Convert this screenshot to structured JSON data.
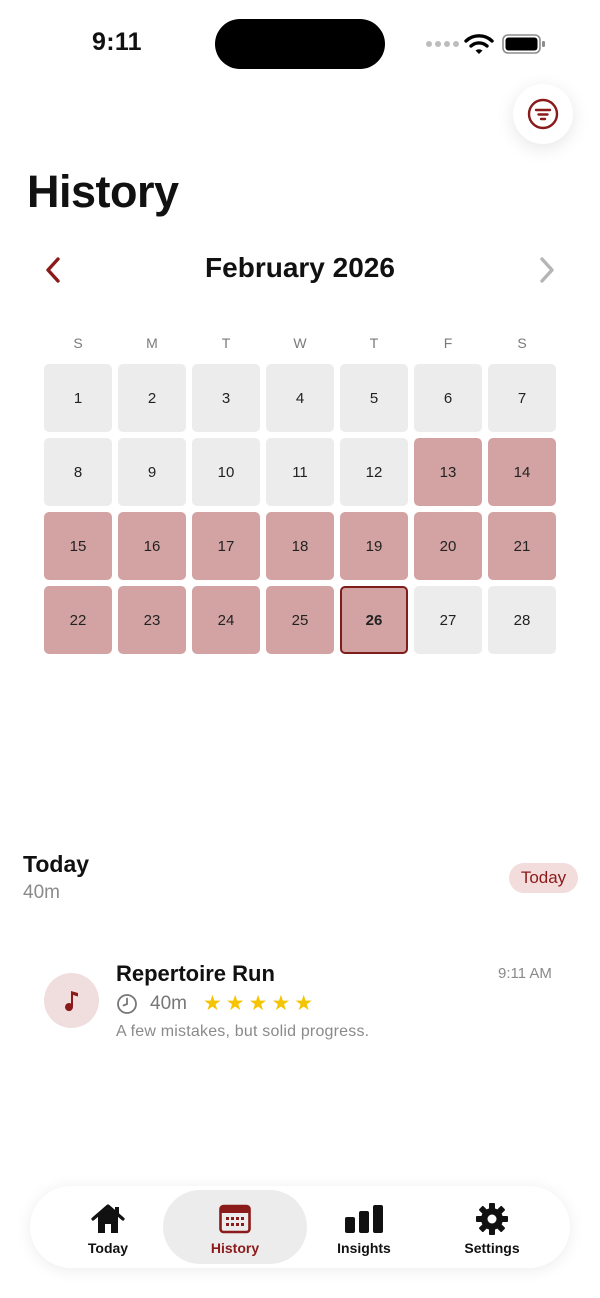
{
  "status_bar": {
    "time": "9:11"
  },
  "header": {
    "title": "History",
    "filter_icon": "filter-icon"
  },
  "calendar": {
    "month_label": "February 2026",
    "prev_icon": "chevron-left-icon",
    "next_icon": "chevron-right-icon",
    "weekdays": [
      "S",
      "M",
      "T",
      "W",
      "T",
      "F",
      "S"
    ],
    "days": [
      {
        "label": "1",
        "active": false,
        "selected": false
      },
      {
        "label": "2",
        "active": false,
        "selected": false
      },
      {
        "label": "3",
        "active": false,
        "selected": false
      },
      {
        "label": "4",
        "active": false,
        "selected": false
      },
      {
        "label": "5",
        "active": false,
        "selected": false
      },
      {
        "label": "6",
        "active": false,
        "selected": false
      },
      {
        "label": "7",
        "active": false,
        "selected": false
      },
      {
        "label": "8",
        "active": false,
        "selected": false
      },
      {
        "label": "9",
        "active": false,
        "selected": false
      },
      {
        "label": "10",
        "active": false,
        "selected": false
      },
      {
        "label": "11",
        "active": false,
        "selected": false
      },
      {
        "label": "12",
        "active": false,
        "selected": false
      },
      {
        "label": "13",
        "active": true,
        "selected": false
      },
      {
        "label": "14",
        "active": true,
        "selected": false
      },
      {
        "label": "15",
        "active": true,
        "selected": false
      },
      {
        "label": "16",
        "active": true,
        "selected": false
      },
      {
        "label": "17",
        "active": true,
        "selected": false
      },
      {
        "label": "18",
        "active": true,
        "selected": false
      },
      {
        "label": "19",
        "active": true,
        "selected": false
      },
      {
        "label": "20",
        "active": true,
        "selected": false
      },
      {
        "label": "21",
        "active": true,
        "selected": false
      },
      {
        "label": "22",
        "active": true,
        "selected": false
      },
      {
        "label": "23",
        "active": true,
        "selected": false
      },
      {
        "label": "24",
        "active": true,
        "selected": false
      },
      {
        "label": "25",
        "active": true,
        "selected": false
      },
      {
        "label": "26",
        "active": true,
        "selected": true
      },
      {
        "label": "27",
        "active": false,
        "selected": false
      },
      {
        "label": "28",
        "active": false,
        "selected": false
      }
    ]
  },
  "summary": {
    "title": "Today",
    "duration": "40m",
    "badge": "Today"
  },
  "session": {
    "icon": "music-note-icon",
    "title": "Repertoire Run",
    "time": "9:11 AM",
    "duration": "40m",
    "rating": 5,
    "note": "A few mistakes, but solid progress."
  },
  "tab_bar": {
    "tabs": [
      {
        "label": "Today",
        "icon": "home-icon",
        "selected": false
      },
      {
        "label": "History",
        "icon": "calendar-icon",
        "selected": true
      },
      {
        "label": "Insights",
        "icon": "bar-chart-icon",
        "selected": false
      },
      {
        "label": "Settings",
        "icon": "gear-icon",
        "selected": false
      }
    ]
  },
  "colors": {
    "accent": "#8b1a1a",
    "active_day": "#d3a3a3",
    "inactive_day": "#ececec",
    "badge_bg": "#f3dcdc",
    "star": "#f5c400"
  }
}
